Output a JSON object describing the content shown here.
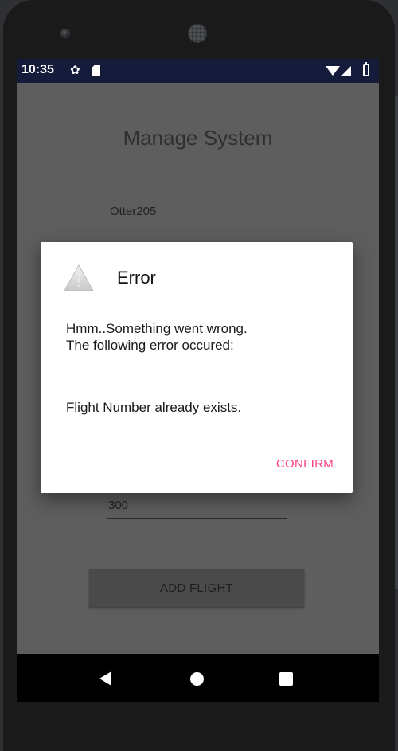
{
  "status_bar": {
    "time": "10:35",
    "icons": [
      "settings-gear-icon",
      "sd-card-icon",
      "wifi-icon",
      "cell-signal-icon",
      "battery-icon"
    ]
  },
  "page": {
    "title": "Manage System"
  },
  "form": {
    "field_1_value": "Otter205",
    "field_2_value": "300",
    "add_button_label": "ADD FLIGHT"
  },
  "dialog": {
    "icon": "warning-icon",
    "title": "Error",
    "message_line_1": "Hmm..Something went wrong.",
    "message_line_2": "The following error occured:",
    "detail": "Flight Number already exists.",
    "confirm_label": "CONFIRM",
    "accent_color": "#ff4081"
  },
  "navigation": {
    "icons": [
      "back-icon",
      "home-icon",
      "recent-apps-icon"
    ]
  },
  "colors": {
    "status_bar": "#151b3a",
    "scrim_background": "#5e5e5e",
    "nav_bar": "#000000"
  }
}
